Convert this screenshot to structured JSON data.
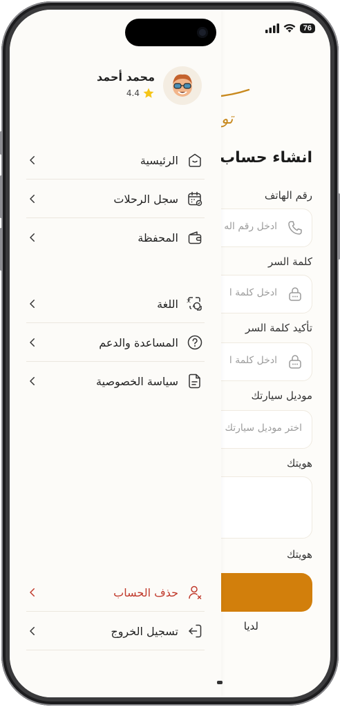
{
  "status_bar": {
    "battery": "76"
  },
  "user": {
    "name": "محمد أحمد",
    "rating": "4.4"
  },
  "drawer": {
    "items": [
      {
        "label": "الرئيسية",
        "icon": "home-icon"
      },
      {
        "label": "سجل الرحلات",
        "icon": "calendar-icon"
      },
      {
        "label": "المحفظة",
        "icon": "wallet-icon"
      },
      {
        "label": "اللغة",
        "icon": "language-icon"
      },
      {
        "label": "المساعدة والدعم",
        "icon": "help-icon"
      },
      {
        "label": "سياسة الخصوصية",
        "icon": "document-icon"
      }
    ],
    "delete_account": "حذف الحساب",
    "logout": "تسجيل الخروج"
  },
  "form": {
    "logo_partial": "تو",
    "title": "انشاء حساب",
    "phone_label": "رقم الهاتف",
    "phone_placeholder": "ادخل رقم اله",
    "password_label": "كلمة السر",
    "password_placeholder": "ادخل كلمة ا",
    "confirm_label": "تأكيد كلمة السر",
    "confirm_placeholder": "ادخل كلمة ا",
    "car_label": "موديل سيارتك",
    "car_placeholder": "اختر موديل سيارتك",
    "id_label": "هويتك",
    "id_partial": "ه",
    "id_label_2": "هويتك",
    "bottom_partial": "لديا"
  },
  "colors": {
    "accent": "#d27f0c",
    "danger": "#c0392b",
    "star": "#f5c518"
  }
}
